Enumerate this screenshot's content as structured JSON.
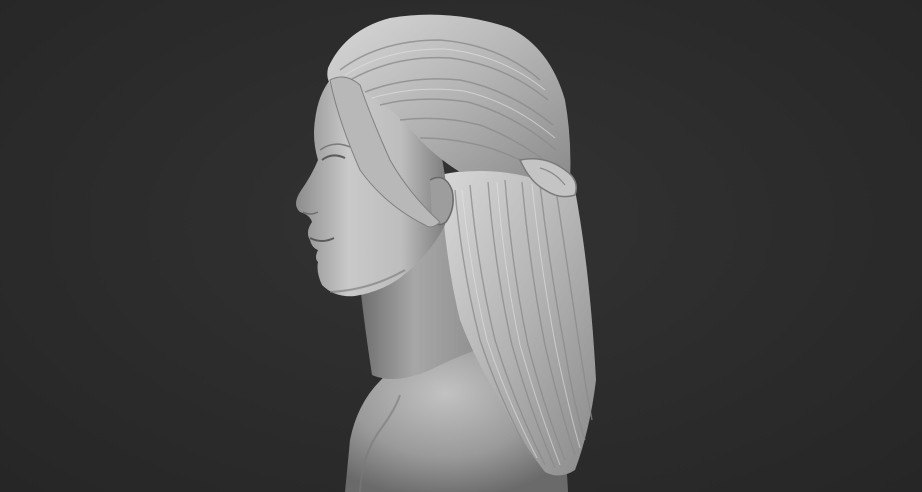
{
  "scene": {
    "subject": "sculpt-bust-profile",
    "colors": {
      "background": "#2d2d2d",
      "clay_light": "#d6d6d6",
      "clay_mid": "#a9a9a9",
      "clay_dark": "#6f6f6f",
      "shadow": "#4a4a4a"
    }
  }
}
